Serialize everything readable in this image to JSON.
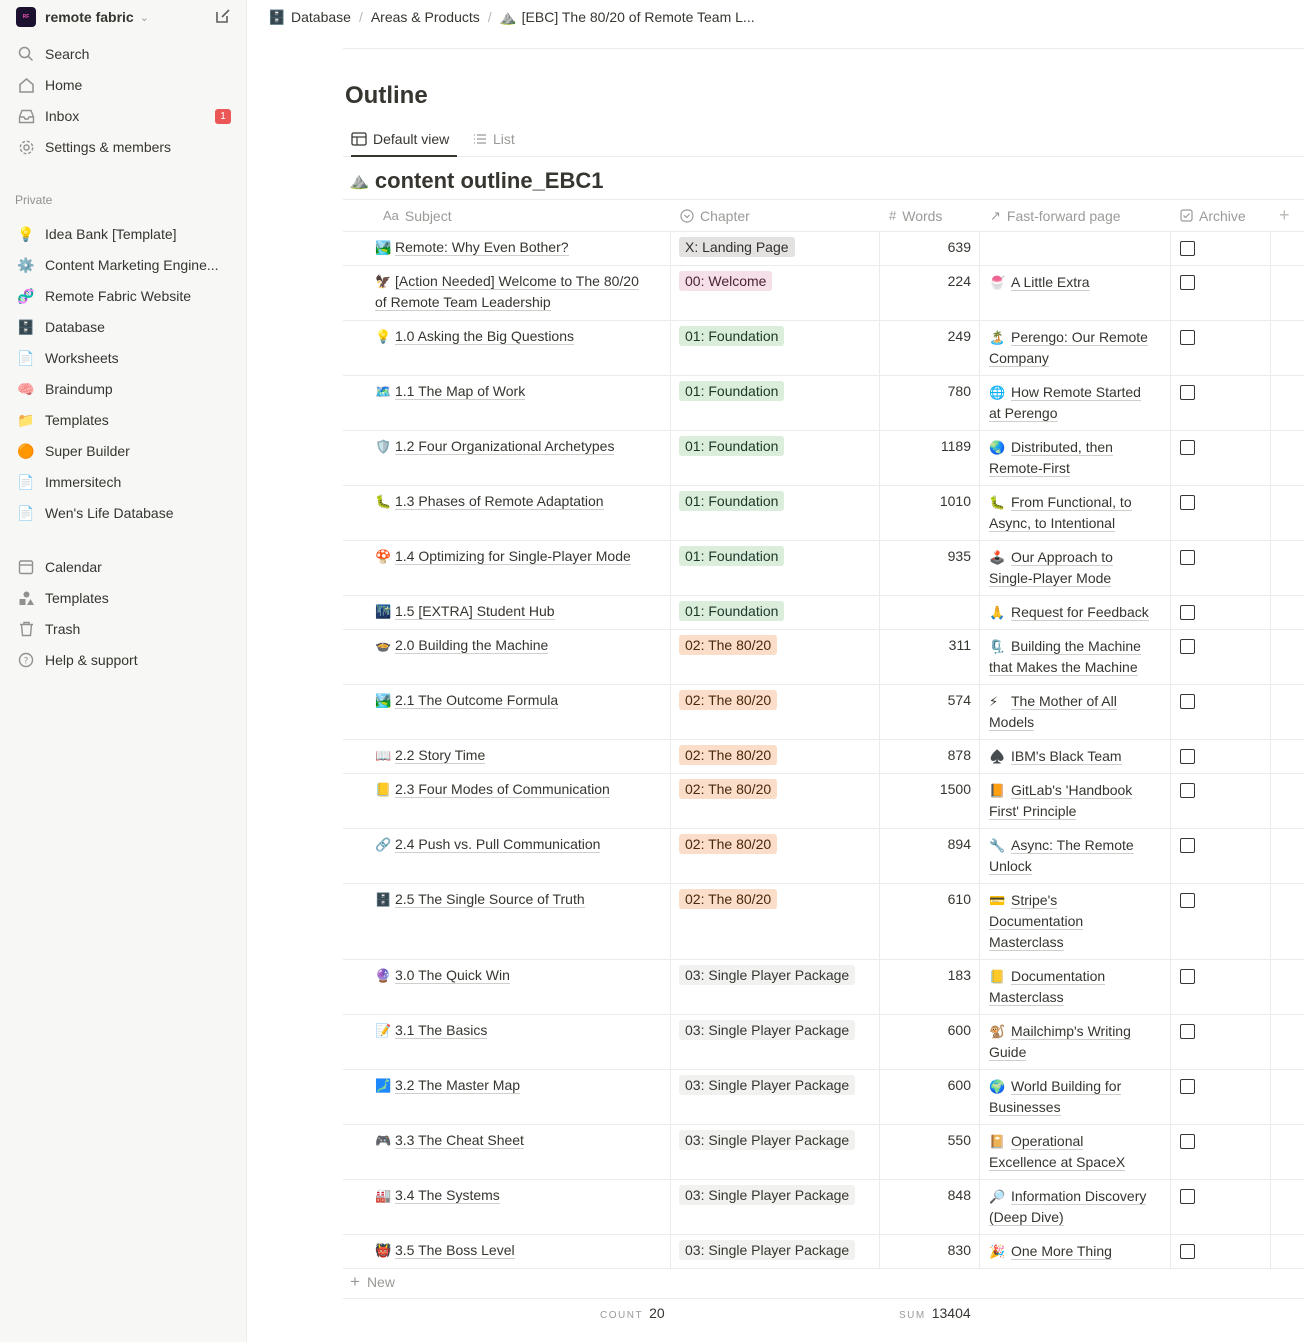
{
  "workspace": {
    "name": "remote fabric",
    "logo_text": "remote fabric"
  },
  "sidebar": {
    "top_items": [
      {
        "label": "Search",
        "icon": "search-icon"
      },
      {
        "label": "Home",
        "icon": "home-icon"
      },
      {
        "label": "Inbox",
        "icon": "inbox-icon",
        "badge": "1"
      },
      {
        "label": "Settings & members",
        "icon": "gear-icon"
      }
    ],
    "private_label": "Private",
    "private_items": [
      {
        "label": "Idea Bank [Template]",
        "emoji": "💡"
      },
      {
        "label": "Content Marketing Engine...",
        "emoji": "⚙️"
      },
      {
        "label": "Remote Fabric Website",
        "emoji": "🧬"
      },
      {
        "label": "Database",
        "emoji": "🗄️"
      },
      {
        "label": "Worksheets",
        "emoji": "📄"
      },
      {
        "label": "Braindump",
        "emoji": "🧠"
      },
      {
        "label": "Templates",
        "emoji": "📁"
      },
      {
        "label": "Super Builder",
        "emoji": "🟠"
      },
      {
        "label": "Immersitech",
        "emoji": "📄"
      },
      {
        "label": "Wen's Life Database",
        "emoji": "📄"
      }
    ],
    "bottom_items": [
      {
        "label": "Calendar",
        "icon": "calendar-icon"
      },
      {
        "label": "Templates",
        "icon": "templates-icon"
      },
      {
        "label": "Trash",
        "icon": "trash-icon"
      },
      {
        "label": "Help & support",
        "icon": "help-icon"
      }
    ]
  },
  "breadcrumb": [
    "Database",
    "Areas & Products",
    "[EBC] The 80/20 of Remote Team L..."
  ],
  "page": {
    "title": "Outline"
  },
  "views": [
    {
      "label": "Default view",
      "active": true
    },
    {
      "label": "List",
      "active": false
    }
  ],
  "database": {
    "title": "content outline_EBC1",
    "columns": [
      "Subject",
      "Chapter",
      "Words",
      "Fast-forward page",
      "Archive"
    ],
    "new_label": "New",
    "footer": {
      "count_label": "COUNT",
      "count": "20",
      "sum_label": "SUM",
      "sum": "13404"
    }
  },
  "rows": [
    {
      "emoji": "🏞️",
      "subject": [
        "Remote: Why Even Bother?"
      ],
      "chapter": "X: Landing Page",
      "tag": "gray",
      "words": "639",
      "ff_emoji": "",
      "ff": []
    },
    {
      "emoji": "🦅",
      "subject": [
        "[Action Needed] Welcome to The 80/20",
        "of Remote Team Leadership"
      ],
      "chapter": "00: Welcome",
      "tag": "pink",
      "words": "224",
      "ff_emoji": "🍧",
      "ff": [
        "A Little Extra"
      ]
    },
    {
      "emoji": "💡",
      "subject": [
        "1.0 Asking the Big Questions"
      ],
      "chapter": "01: Foundation",
      "tag": "green",
      "words": "249",
      "ff_emoji": "🏝️",
      "ff": [
        "Perengo: Our Remote",
        "Company"
      ]
    },
    {
      "emoji": "🗺️",
      "subject": [
        "1.1 The Map of Work"
      ],
      "chapter": "01: Foundation",
      "tag": "green",
      "words": "780",
      "ff_emoji": "🌐",
      "ff": [
        "How Remote Started",
        "at Perengo"
      ]
    },
    {
      "emoji": "🛡️",
      "subject": [
        "1.2 Four Organizational Archetypes"
      ],
      "chapter": "01: Foundation",
      "tag": "green",
      "words": "1189",
      "ff_emoji": "🌏",
      "ff": [
        "Distributed, then",
        "Remote-First"
      ]
    },
    {
      "emoji": "🐛",
      "subject": [
        "1.3 Phases of Remote Adaptation"
      ],
      "chapter": "01: Foundation",
      "tag": "green",
      "words": "1010",
      "ff_emoji": "🐛",
      "ff": [
        "From Functional, to",
        "Async, to Intentional"
      ]
    },
    {
      "emoji": "🍄",
      "subject": [
        "1.4 Optimizing for Single-Player Mode"
      ],
      "chapter": "01: Foundation",
      "tag": "green",
      "words": "935",
      "ff_emoji": "🕹️",
      "ff": [
        "Our Approach to",
        "Single-Player Mode"
      ]
    },
    {
      "emoji": "🌃",
      "subject": [
        "1.5 [EXTRA] Student Hub"
      ],
      "chapter": "01: Foundation",
      "tag": "green",
      "words": "",
      "ff_emoji": "🙏",
      "ff": [
        "Request for Feedback"
      ]
    },
    {
      "emoji": "🍲",
      "subject": [
        "2.0 Building the Machine"
      ],
      "chapter": "02: The 80/20",
      "tag": "orange",
      "words": "311",
      "ff_emoji": "🗜️",
      "ff": [
        "Building the Machine",
        "that Makes the Machine"
      ]
    },
    {
      "emoji": "🏞️",
      "subject": [
        "2.1 The Outcome Formula"
      ],
      "chapter": "02: The 80/20",
      "tag": "orange",
      "words": "574",
      "ff_emoji": "⚡",
      "ff": [
        "The Mother of All",
        "Models"
      ]
    },
    {
      "emoji": "📖",
      "subject": [
        "2.2 Story Time"
      ],
      "chapter": "02: The 80/20",
      "tag": "orange",
      "words": "878",
      "ff_emoji": "♠️",
      "ff": [
        "IBM's Black Team"
      ]
    },
    {
      "emoji": "📒",
      "subject": [
        "2.3 Four Modes of Communication"
      ],
      "chapter": "02: The 80/20",
      "tag": "orange",
      "words": "1500",
      "ff_emoji": "📙",
      "ff": [
        "GitLab's 'Handbook",
        "First' Principle"
      ]
    },
    {
      "emoji": "🔗",
      "subject": [
        "2.4 Push vs. Pull Communication"
      ],
      "chapter": "02: The 80/20",
      "tag": "orange",
      "words": "894",
      "ff_emoji": "🔧",
      "ff": [
        "Async: The Remote",
        "Unlock"
      ]
    },
    {
      "emoji": "🗄️",
      "subject": [
        "2.5 The Single Source of Truth"
      ],
      "chapter": "02: The 80/20",
      "tag": "orange",
      "words": "610",
      "ff_emoji": "💳",
      "ff": [
        "Stripe's",
        "Documentation",
        "Masterclass"
      ]
    },
    {
      "emoji": "🔮",
      "subject": [
        "3.0 The Quick Win"
      ],
      "chapter": "03: Single Player Package",
      "tag": "plain",
      "words": "183",
      "ff_emoji": "📒",
      "ff": [
        "Documentation",
        "Masterclass"
      ]
    },
    {
      "emoji": "📝",
      "subject": [
        "3.1 The Basics"
      ],
      "chapter": "03: Single Player Package",
      "tag": "plain",
      "words": "600",
      "ff_emoji": "🐒",
      "ff": [
        "Mailchimp's Writing",
        "Guide"
      ]
    },
    {
      "emoji": "🗾",
      "subject": [
        "3.2 The Master Map"
      ],
      "chapter": "03: Single Player Package",
      "tag": "plain",
      "words": "600",
      "ff_emoji": "🌍",
      "ff": [
        "World Building for",
        "Businesses"
      ]
    },
    {
      "emoji": "🎮",
      "subject": [
        "3.3 The Cheat Sheet"
      ],
      "chapter": "03: Single Player Package",
      "tag": "plain",
      "words": "550",
      "ff_emoji": "📔",
      "ff": [
        "Operational",
        "Excellence at SpaceX"
      ]
    },
    {
      "emoji": "🏭",
      "subject": [
        "3.4 The Systems"
      ],
      "chapter": "03: Single Player Package",
      "tag": "plain",
      "words": "848",
      "ff_emoji": "🔎",
      "ff": [
        "Information Discovery",
        "(Deep Dive)"
      ]
    },
    {
      "emoji": "👹",
      "subject": [
        "3.5 The Boss Level"
      ],
      "chapter": "03: Single Player Package",
      "tag": "plain",
      "words": "830",
      "ff_emoji": "🎉",
      "ff": [
        "One More Thing"
      ]
    }
  ]
}
